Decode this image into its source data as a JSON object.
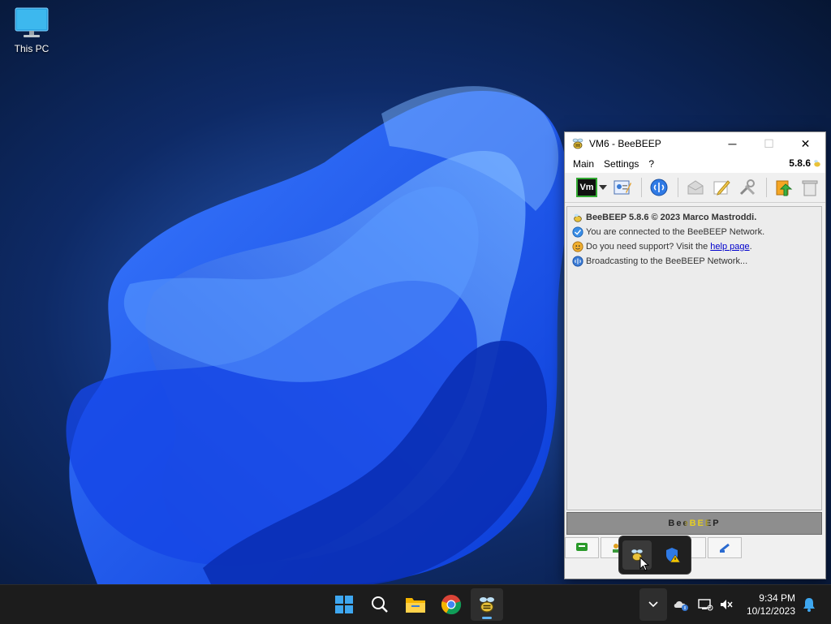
{
  "desktop": {
    "icons": [
      {
        "label": "This PC",
        "icon": "monitor-icon"
      }
    ]
  },
  "window": {
    "title": "VM6 - BeeBEEP",
    "controls": {
      "minimize": "─",
      "maximize": "☐",
      "close": "✕"
    },
    "menu": [
      "Main",
      "Settings",
      "?"
    ],
    "version": "5.8.6",
    "toolbar": {
      "status_label": "Vm",
      "buttons": [
        "edit-profile-icon",
        "network-icon",
        "mail-icon",
        "edit-icon",
        "tools-icon",
        "save-icon",
        "trash-icon"
      ]
    },
    "chat": {
      "line1": "BeeBEEP 5.8.6 © 2023 Marco Mastroddi.",
      "line2": "You are connected to the BeeBEEP Network.",
      "line3_prefix": "Do you need support? Visit the ",
      "line3_link": "help page",
      "line3_suffix": ".",
      "line4": "Broadcasting to the BeeBEEP Network..."
    },
    "logo": "BeeBEEP"
  },
  "tray_popup": {
    "icons": [
      "beebeep-tray-icon",
      "security-warning-icon"
    ]
  },
  "taskbar": {
    "time": "9:34 PM",
    "date": "10/12/2023",
    "overflow_label": "⌃"
  },
  "colors": {
    "accent": "#5fb2f2",
    "taskbar": "#1c1c1c",
    "link": "#0000cc"
  }
}
